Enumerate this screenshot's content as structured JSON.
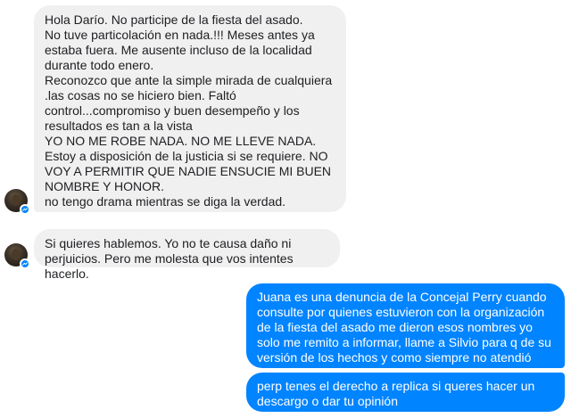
{
  "conversation": {
    "messages": [
      {
        "sender": "contact",
        "text": "Hola Darío. No participe de la fiesta del asado.\nNo tuve particolación en nada.!!! Meses antes ya estaba fuera. Me ausente incluso de la localidad durante todo enero.\nReconozco que ante la simple mirada de cualquiera .las cosas no se hiciero bien. Faltó control...compromiso y buen desempeño y los resultados es tan a la vista\nYO NO ME ROBE NADA. NO ME LLEVE NADA. Estoy a disposición de la justicia si se requiere. NO VOY A PERMITIR QUE NADIE ENSUCIE MI BUEN NOMBRE Y HONOR.\nno tengo drama mientras se diga la verdad."
      },
      {
        "sender": "contact",
        "text": "Si quieres hablemos. Yo no te causa daño ni perjuicios. Pero me molesta que vos intentes hacerlo."
      },
      {
        "sender": "me",
        "text": "Juana es una denuncia de la Concejal Perry cuando consulte por quienes estuvieron con la organización de la fiesta del asado me dieron esos nombres yo solo me remito a informar, llame a Silvio para q de su versión de los hechos y como siempre no atendió"
      },
      {
        "sender": "me",
        "text": "perp tenes el derecho a replica si queres hacer un descargo o dar tu opinión"
      }
    ]
  },
  "colors": {
    "incoming_bubble": "#f1f0f0",
    "outgoing_bubble": "#0084ff",
    "messenger_badge": "#0084ff"
  },
  "icons": {
    "avatar_badge": "messenger-bolt-icon"
  }
}
